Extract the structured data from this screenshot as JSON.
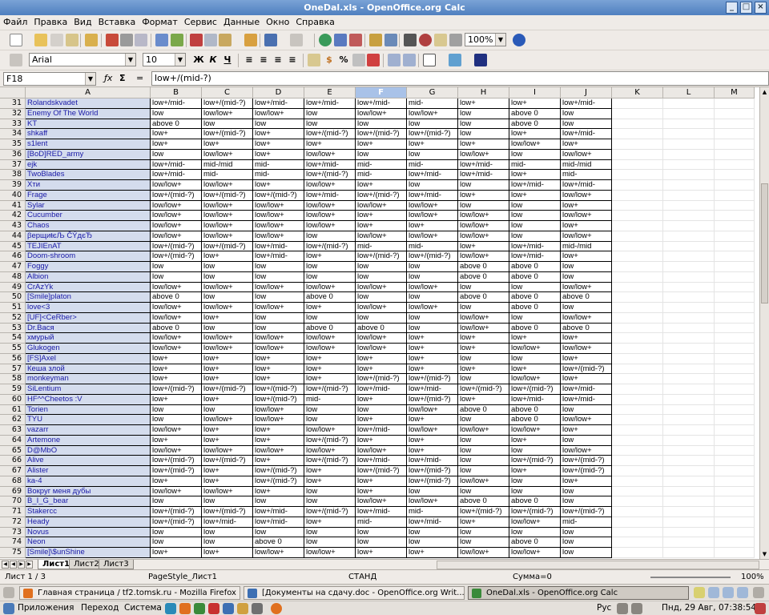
{
  "window": {
    "title": "OneDal.xls - OpenOffice.org Calc"
  },
  "menu": [
    "Файл",
    "Правка",
    "Вид",
    "Вставка",
    "Формат",
    "Сервис",
    "Данные",
    "Окно",
    "Справка"
  ],
  "toolbar": {
    "zoom": "100%"
  },
  "format": {
    "font": "Arial",
    "size": "10"
  },
  "formula": {
    "cell_ref": "F18",
    "content": "low+/(mid-?)"
  },
  "columns": [
    "A",
    "B",
    "C",
    "D",
    "E",
    "F",
    "G",
    "H",
    "I",
    "J",
    "K",
    "L",
    "M"
  ],
  "selected_column": "F",
  "rows": [
    {
      "n": "31",
      "c": [
        "Rolandskvadet",
        "low+/mid-",
        "low+/(mid-?)",
        "low+/mid-",
        "low+/mid-",
        "low+/mid-",
        "mid-",
        "low+",
        "low+",
        "low+/mid-"
      ]
    },
    {
      "n": "32",
      "c": [
        "Enemy Of The World",
        "low",
        "low/low+",
        "low/low+",
        "low",
        "low/low+",
        "low/low+",
        "low",
        "above 0",
        "low"
      ]
    },
    {
      "n": "33",
      "c": [
        "KT",
        "above 0",
        "low",
        "low",
        "low",
        "low",
        "low",
        "low",
        "above 0",
        "low"
      ]
    },
    {
      "n": "34",
      "c": [
        "shkaff",
        "low+",
        "low+/(mid-?)",
        "low+",
        "low+/(mid-?)",
        "low+/(mid-?)",
        "low+/(mid-?)",
        "low",
        "low+",
        "low+/mid-"
      ]
    },
    {
      "n": "35",
      "c": [
        "s1lent",
        "low+",
        "low+",
        "low+",
        "low+",
        "low+",
        "low+",
        "low+",
        "low/low+",
        "low+"
      ]
    },
    {
      "n": "36",
      "c": [
        "[BoD]RED_army",
        "low",
        "low/low+",
        "low+",
        "low/low+",
        "low",
        "low",
        "low/low+",
        "low",
        "low/low+"
      ]
    },
    {
      "n": "37",
      "c": [
        "ejk",
        "low+/mid-",
        "mid-/mid",
        "mid-",
        "low+/mid-",
        "mid-",
        "mid-",
        "low+/mid-",
        "mid-",
        "mid-/mid"
      ]
    },
    {
      "n": "38",
      "c": [
        "TwoBlades",
        "low+/mid-",
        "mid-",
        "mid-",
        "low+/(mid-?)",
        "mid-",
        "low+/mid-",
        "low+/mid-",
        "low+",
        "mid-"
      ]
    },
    {
      "n": "39",
      "c": [
        "Xти",
        "low/low+",
        "low/low+",
        "low+",
        "low/low+",
        "low+",
        "low",
        "low",
        "low+/mid-",
        "low+/mid-"
      ]
    },
    {
      "n": "40",
      "c": [
        "Frage",
        "low+/(mid-?)",
        "low+/(mid-?)",
        "low+/(mid-?)",
        "low+/mid-",
        "low+/(mid-?)",
        "low+/mid-",
        "low+",
        "low+",
        "low/low+"
      ]
    },
    {
      "n": "41",
      "c": [
        "Sylar",
        "low/low+",
        "low/low+",
        "low/low+",
        "low/low+",
        "low/low+",
        "low/low+",
        "low",
        "low",
        "low+"
      ]
    },
    {
      "n": "42",
      "c": [
        "Cucumber",
        "low/low+",
        "low/low+",
        "low/low+",
        "low/low+",
        "low+",
        "low/low+",
        "low/low+",
        "low",
        "low/low+"
      ]
    },
    {
      "n": "43",
      "c": [
        "Chaos",
        "low/low+",
        "low/low+",
        "low/low+",
        "low/low+",
        "low+",
        "low+",
        "low/low+",
        "low",
        "low+"
      ]
    },
    {
      "n": "44",
      "c": [
        "βерщиŧєЉ ĈÝдєЂ",
        "low/low+",
        "low/low+",
        "low/low+",
        "low",
        "low/low+",
        "low/low+",
        "low/low+",
        "low",
        "low/low+"
      ]
    },
    {
      "n": "45",
      "c": [
        "TEJIEnAT",
        "low+/(mid-?)",
        "low+/(mid-?)",
        "low+/mid-",
        "low+/(mid-?)",
        "mid-",
        "mid-",
        "low+",
        "low+/mid-",
        "mid-/mid"
      ]
    },
    {
      "n": "46",
      "c": [
        "Doom-shroom",
        "low+/(mid-?)",
        "low+",
        "low+/mid-",
        "low+",
        "low+/(mid-?)",
        "low+/(mid-?)",
        "low/low+",
        "low+/mid-",
        "low+"
      ]
    },
    {
      "n": "47",
      "c": [
        "Foggy",
        "low",
        "low",
        "low",
        "low",
        "low",
        "low",
        "above 0",
        "above 0",
        "low"
      ]
    },
    {
      "n": "48",
      "c": [
        "Albion",
        "low",
        "low",
        "low",
        "low",
        "low",
        "low",
        "above 0",
        "above 0",
        "low"
      ]
    },
    {
      "n": "49",
      "c": [
        "CrAzYk",
        "low/low+",
        "low/low+",
        "low/low+",
        "low/low+",
        "low/low+",
        "low/low+",
        "low",
        "low",
        "low/low+"
      ]
    },
    {
      "n": "50",
      "c": [
        "[Smile]platon",
        "above 0",
        "low",
        "low",
        "above 0",
        "low",
        "low",
        "above 0",
        "above 0",
        "above 0"
      ]
    },
    {
      "n": "51",
      "c": [
        "love<3",
        "low/low+",
        "low/low+",
        "low/low+",
        "low+",
        "low/low+",
        "low/low+",
        "low",
        "above 0",
        "low"
      ]
    },
    {
      "n": "52",
      "c": [
        "[UF]<CeRber>",
        "low/low+",
        "low+",
        "low",
        "low",
        "low",
        "low",
        "low/low+",
        "low",
        "low/low+"
      ]
    },
    {
      "n": "53",
      "c": [
        "Dr.Вася",
        "above 0",
        "low",
        "low",
        "above 0",
        "above 0",
        "low",
        "low/low+",
        "above 0",
        "above 0"
      ]
    },
    {
      "n": "54",
      "c": [
        "хмурый",
        "low/low+",
        "low/low+",
        "low/low+",
        "low/low+",
        "low/low+",
        "low+",
        "low+",
        "low+",
        "low+"
      ]
    },
    {
      "n": "55",
      "c": [
        "Glukogen",
        "low/low+",
        "low/low+",
        "low/low+",
        "low/low+",
        "low/low+",
        "low+",
        "low+",
        "low/low+",
        "low/low+"
      ]
    },
    {
      "n": "56",
      "c": [
        "[FS]Axel",
        "low+",
        "low+",
        "low+",
        "low+",
        "low+",
        "low+",
        "low",
        "low",
        "low+"
      ]
    },
    {
      "n": "57",
      "c": [
        "Кеша злой",
        "low+",
        "low+",
        "low+",
        "low+",
        "low+",
        "low+",
        "low+",
        "low+",
        "low+/(mid-?)"
      ]
    },
    {
      "n": "58",
      "c": [
        "monkeyman",
        "low+",
        "low+",
        "low+",
        "low+",
        "low+/(mid-?)",
        "low+/(mid-?)",
        "low",
        "low/low+",
        "low+"
      ]
    },
    {
      "n": "59",
      "c": [
        "SiLentium",
        "low+/(mid-?)",
        "low+/(mid-?)",
        "low+/(mid-?)",
        "low+/(mid-?)",
        "low+/mid-",
        "low+/mid-",
        "low+/(mid-?)",
        "low+/(mid-?)",
        "low+/mid-"
      ]
    },
    {
      "n": "60",
      "c": [
        "HF^^Cheetos :V",
        "low+",
        "low+",
        "low+/(mid-?)",
        "mid-",
        "low+",
        "low+/(mid-?)",
        "low+",
        "low+/mid-",
        "low+/mid-"
      ]
    },
    {
      "n": "61",
      "c": [
        "Torien",
        "low",
        "low",
        "low/low+",
        "low",
        "low",
        "low/low+",
        "above 0",
        "above 0",
        "low"
      ]
    },
    {
      "n": "62",
      "c": [
        "TYU",
        "low",
        "low/low+",
        "low/low+",
        "low",
        "low+",
        "low+",
        "low",
        "above 0",
        "low/low+"
      ]
    },
    {
      "n": "63",
      "c": [
        "vazarr",
        "low/low+",
        "low+",
        "low+",
        "low/low+",
        "low+/mid-",
        "low/low+",
        "low/low+",
        "low/low+",
        "low+"
      ]
    },
    {
      "n": "64",
      "c": [
        "Artemone",
        "low+",
        "low+",
        "low+",
        "low+/(mid-?)",
        "low+",
        "low+",
        "low",
        "low+",
        "low"
      ]
    },
    {
      "n": "65",
      "c": [
        "D@MbO",
        "low/low+",
        "low/low+",
        "low/low+",
        "low/low+",
        "low/low+",
        "low+",
        "low",
        "low",
        "low/low+"
      ]
    },
    {
      "n": "66",
      "c": [
        "Alive",
        "low+/(mid-?)",
        "low+/(mid-?)",
        "low+",
        "low+/(mid-?)",
        "low+/mid-",
        "low+/mid-",
        "low",
        "low+/(mid-?)",
        "low+/(mid-?)"
      ]
    },
    {
      "n": "67",
      "c": [
        "Alister",
        "low+/(mid-?)",
        "low+",
        "low+/(mid-?)",
        "low+",
        "low+/(mid-?)",
        "low+/(mid-?)",
        "low",
        "low+",
        "low+/(mid-?)"
      ]
    },
    {
      "n": "68",
      "c": [
        "ka-4",
        "low+",
        "low+",
        "low+/(mid-?)",
        "low+",
        "low+",
        "low+/(mid-?)",
        "low/low+",
        "low",
        "low+"
      ]
    },
    {
      "n": "69",
      "c": [
        "Вокруг меня дубы",
        "low/low+",
        "low/low+",
        "low+",
        "low",
        "low+",
        "low",
        "low",
        "low",
        "low"
      ]
    },
    {
      "n": "70",
      "c": [
        "B_I_G_bear",
        "low",
        "low",
        "low",
        "low",
        "low/low+",
        "low/low+",
        "above 0",
        "above 0",
        "low"
      ]
    },
    {
      "n": "71",
      "c": [
        "Stakercc",
        "low+/(mid-?)",
        "low+/(mid-?)",
        "low+/mid-",
        "low+/(mid-?)",
        "low+/mid-",
        "mid-",
        "low+/(mid-?)",
        "low+/(mid-?)",
        "low+/(mid-?)"
      ]
    },
    {
      "n": "72",
      "c": [
        "Heady",
        "low+/(mid-?)",
        "low+/mid-",
        "low+/mid-",
        "low+",
        "mid-",
        "low+/mid-",
        "low+",
        "low/low+",
        "mid-"
      ]
    },
    {
      "n": "73",
      "c": [
        "Novus",
        "low",
        "low",
        "low",
        "low",
        "low",
        "low",
        "low",
        "low",
        "low"
      ]
    },
    {
      "n": "74",
      "c": [
        "Neon",
        "low",
        "low",
        "above 0",
        "low",
        "low",
        "low",
        "low",
        "above 0",
        "low"
      ]
    },
    {
      "n": "75",
      "c": [
        "[Smile]\\$unShine",
        "low+",
        "low+",
        "low/low+",
        "low/low+",
        "low+",
        "low+",
        "low/low+",
        "low/low+",
        "low"
      ]
    }
  ],
  "sheet_tabs": [
    "Лист1",
    "Лист2",
    "Лист3"
  ],
  "status": {
    "sheet": "Лист 1 / 3",
    "page_style": "PageStyle_Лист1",
    "mode": "СТАНД",
    "sum": "Сумма=0",
    "zoom": "100%"
  },
  "taskbar": [
    {
      "label": "Главная страница / tf2.tomsk.ru - Mozilla Firefox",
      "color": "#e0701f"
    },
    {
      "label": "[Документы на сдачу.doc - OpenOffice.org Writ...",
      "color": "#3d6fb3"
    },
    {
      "label": "OneDal.xls - OpenOffice.org Calc",
      "color": "#3a8a3a"
    }
  ],
  "panel": {
    "applications": "Приложения",
    "places": "Переход",
    "system": "Система",
    "keyboard": "Рус",
    "clock": "Пнд, 29 Авг, 07:38:54"
  }
}
